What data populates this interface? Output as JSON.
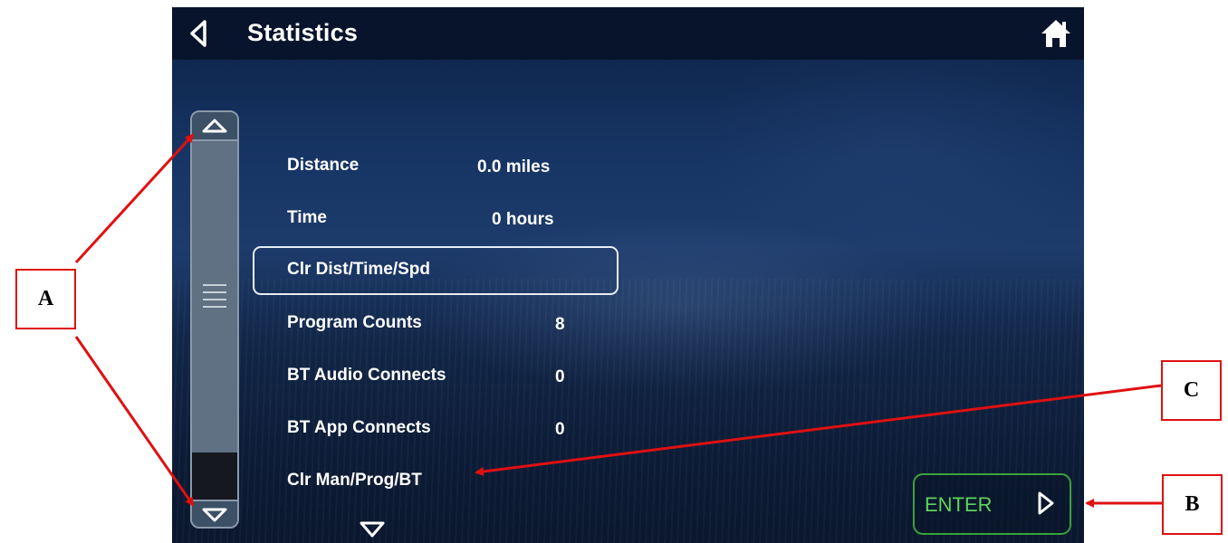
{
  "header": {
    "title": "Statistics"
  },
  "stats": [
    {
      "label": "Distance",
      "value": "0.0 miles"
    },
    {
      "label": "Time",
      "value": "0 hours"
    },
    {
      "label": "Clr Dist/Time/Spd",
      "value": ""
    },
    {
      "label": "Program Counts",
      "value": "8"
    },
    {
      "label": "BT Audio Connects",
      "value": "0"
    },
    {
      "label": "BT App Connects",
      "value": "0"
    },
    {
      "label": "Clr Man/Prog/BT",
      "value": ""
    }
  ],
  "enter_button": {
    "label": "ENTER"
  },
  "callouts": {
    "a": "A",
    "b": "B",
    "c": "C"
  },
  "colors": {
    "annotation": "#e01010",
    "enter_accent": "#39a23c",
    "topbar": "#08142b"
  },
  "icons": [
    "back-icon",
    "home-icon",
    "scroll-up-icon",
    "scroll-down-icon",
    "more-down-icon",
    "enter-arrow-icon"
  ]
}
